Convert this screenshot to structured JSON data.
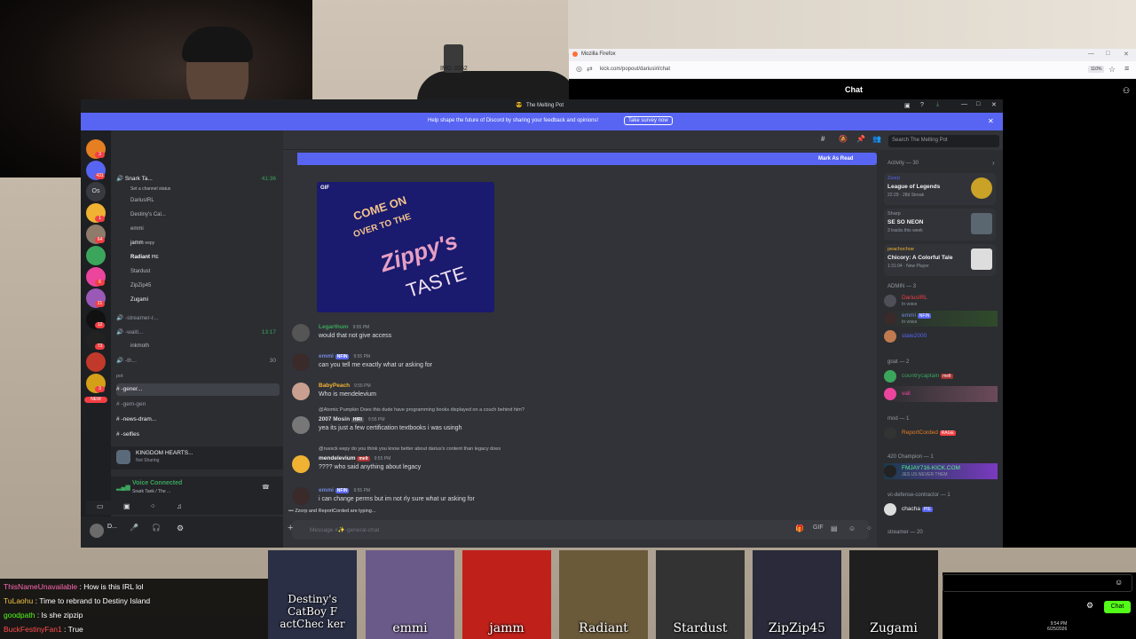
{
  "firefox": {
    "window_title": "Mozilla Firefox",
    "url": "kick.com/popout/dariusirl/chat",
    "zoom": "110%",
    "chat_header": "Chat",
    "chat_button": "Chat"
  },
  "room": {
    "sticker": "IMG 3552"
  },
  "discord": {
    "title": "The Melting Pot",
    "banner_text": "Help shape the future of Discord by sharing your feedback and opinions!",
    "survey_button": "Take survey now",
    "mark_as_read": "Mark As Read",
    "search_placeholder": "Search The Melting Pot",
    "composer_placeholder": "Message #✨-general-chat",
    "typing": "Zzorp and ReportCorded are typing...",
    "channels": {
      "voice1": "Snark Ta...",
      "voice1_timer": "41:36",
      "voice1_status": "Set a channel status",
      "voice1_users": [
        "DariusIRL",
        "Destiny's Cal...",
        "emmi",
        "jamm",
        "Radiant",
        "Stardust",
        "ZipZip45",
        "Zugami"
      ],
      "jamm_tag": "eepy",
      "radiant_tag": "PIE",
      "streamer_channel": "-streamer-r...",
      "waiting_channel": "-waiti...",
      "waiting_timer": "13:17",
      "inkmoth": "inkmoth",
      "th_channel": "-th...",
      "th_count": "30",
      "category": "pot",
      "text_channels": [
        "-gener...",
        "-gem-gen",
        "-news-dram...",
        "-selfies"
      ],
      "badge_new": "NEW"
    },
    "activity_status": {
      "title": "KINGDOM HEARTS...",
      "sub": "Not Sharing"
    },
    "voice_connected": {
      "label": "Voice Connected",
      "sub": "Snark Tank / The ..."
    },
    "user_initial": "D...",
    "guild_badges": [
      "3",
      "431",
      "1",
      "64",
      "6",
      "21",
      "12",
      "73",
      "3"
    ],
    "guild_label_os": "Os",
    "gif_label": "GIF",
    "gif_text": [
      "COME ON",
      "OVER TO THE",
      "Zippy's",
      "TASTE"
    ],
    "messages": [
      {
        "name": "Legarthum",
        "time": "9:55 PM",
        "color": "#3ba55c",
        "text": "would that not give access"
      },
      {
        "name": "emmi",
        "tag": "NFIN",
        "time": "9:55 PM",
        "color": "#7289da",
        "text": "can you tell me exactly what ur asking for"
      },
      {
        "name": "BabyPeach",
        "time": "9:55 PM",
        "color": "#f0b232",
        "text": "Who is mendelevium"
      },
      {
        "reply": "@Atomic Pumpkin Does this dude have programming books displayed on a couch behind him?",
        "name": "2007 Mosin",
        "tag": "HIRI",
        "time": "9:55 PM",
        "color": "#dbdee1",
        "text": "yea its just a few certification textbooks i was usingh"
      },
      {
        "reply": "@ruesck eepy do you think you know better about darius's content than legacy does",
        "name": "mendelevium",
        "tag": "melt",
        "time": "9:55 PM",
        "color": "#f2f3f5",
        "text": "???? who said anything about legacy"
      },
      {
        "name": "emmi",
        "tag": "NFIN",
        "time": "9:55 PM",
        "color": "#7289da",
        "text": "i can change perms but im not rly sure what ur asking for"
      }
    ],
    "members": {
      "activity_header": "Activity — 30",
      "activities": [
        {
          "user": "Zzorp",
          "game": "League of Legends",
          "detail": "22:29 · 28d Streak"
        },
        {
          "user": "Sharp",
          "game": "SE SO NEON",
          "detail": "3 tracks this week"
        },
        {
          "user": "peachochoe",
          "game": "Chicory: A Colorful Tale",
          "detail": "1:31:04 · New Player"
        }
      ],
      "admin_header": "ADMIN — 3",
      "admins": [
        {
          "name": "DariusIRL",
          "sub": "In voice",
          "color": "#f23f43"
        },
        {
          "name": "emmi",
          "tag": "NFIN",
          "sub": "In voice",
          "color": "#7289da"
        },
        {
          "name": "stale2000",
          "sub": "",
          "color": "#5865f2"
        }
      ],
      "goat_header": "goat — 2",
      "goats": [
        {
          "name": "countrycaptain",
          "tag": "melt",
          "color": "#3ba55c"
        },
        {
          "name": "vali",
          "color": "#eb459e"
        }
      ],
      "mod_header": "mod — 1",
      "mods": [
        {
          "name": "ReportCorded",
          "tag": "RAGE",
          "color": "#e67e22"
        }
      ],
      "champion_header": "420 Champion — 1",
      "champions": [
        {
          "name": "FMJAY716-KICK.COM",
          "sub": "JES US NEVER THEM",
          "color": "#57f287"
        }
      ],
      "vdc_header": "vc-defense-contractor — 1",
      "vdc": [
        {
          "name": "chacha",
          "tag": "PIE",
          "color": "#f2f3f5"
        }
      ],
      "streamer_header": "streamer — 20"
    }
  },
  "kick_chat": [
    {
      "user": "ThisNameUnavailable",
      "color": "#ff69b4",
      "text": "How is this IRL lol"
    },
    {
      "user": "TuLaohu",
      "color": "#f5c542",
      "text": "Time to rebrand to Destiny Island"
    },
    {
      "user": "goodpath",
      "color": "#53fc18",
      "text": "Is she zipzip"
    },
    {
      "user": "BuckFestinyFan1",
      "color": "#ff4d4d",
      "text": "True"
    }
  ],
  "emotes": [
    "Destiny's CatBoy F actChec ker",
    "emmi",
    "jamm",
    "Radiant",
    "Stardust",
    "ZipZip45",
    "Zugami"
  ],
  "clock": {
    "time": "9:54 PM",
    "date": "6/25/2026"
  },
  "colors": {
    "discord_bg": "#313338",
    "blurple": "#5865f2",
    "kick_green": "#53fc18"
  }
}
